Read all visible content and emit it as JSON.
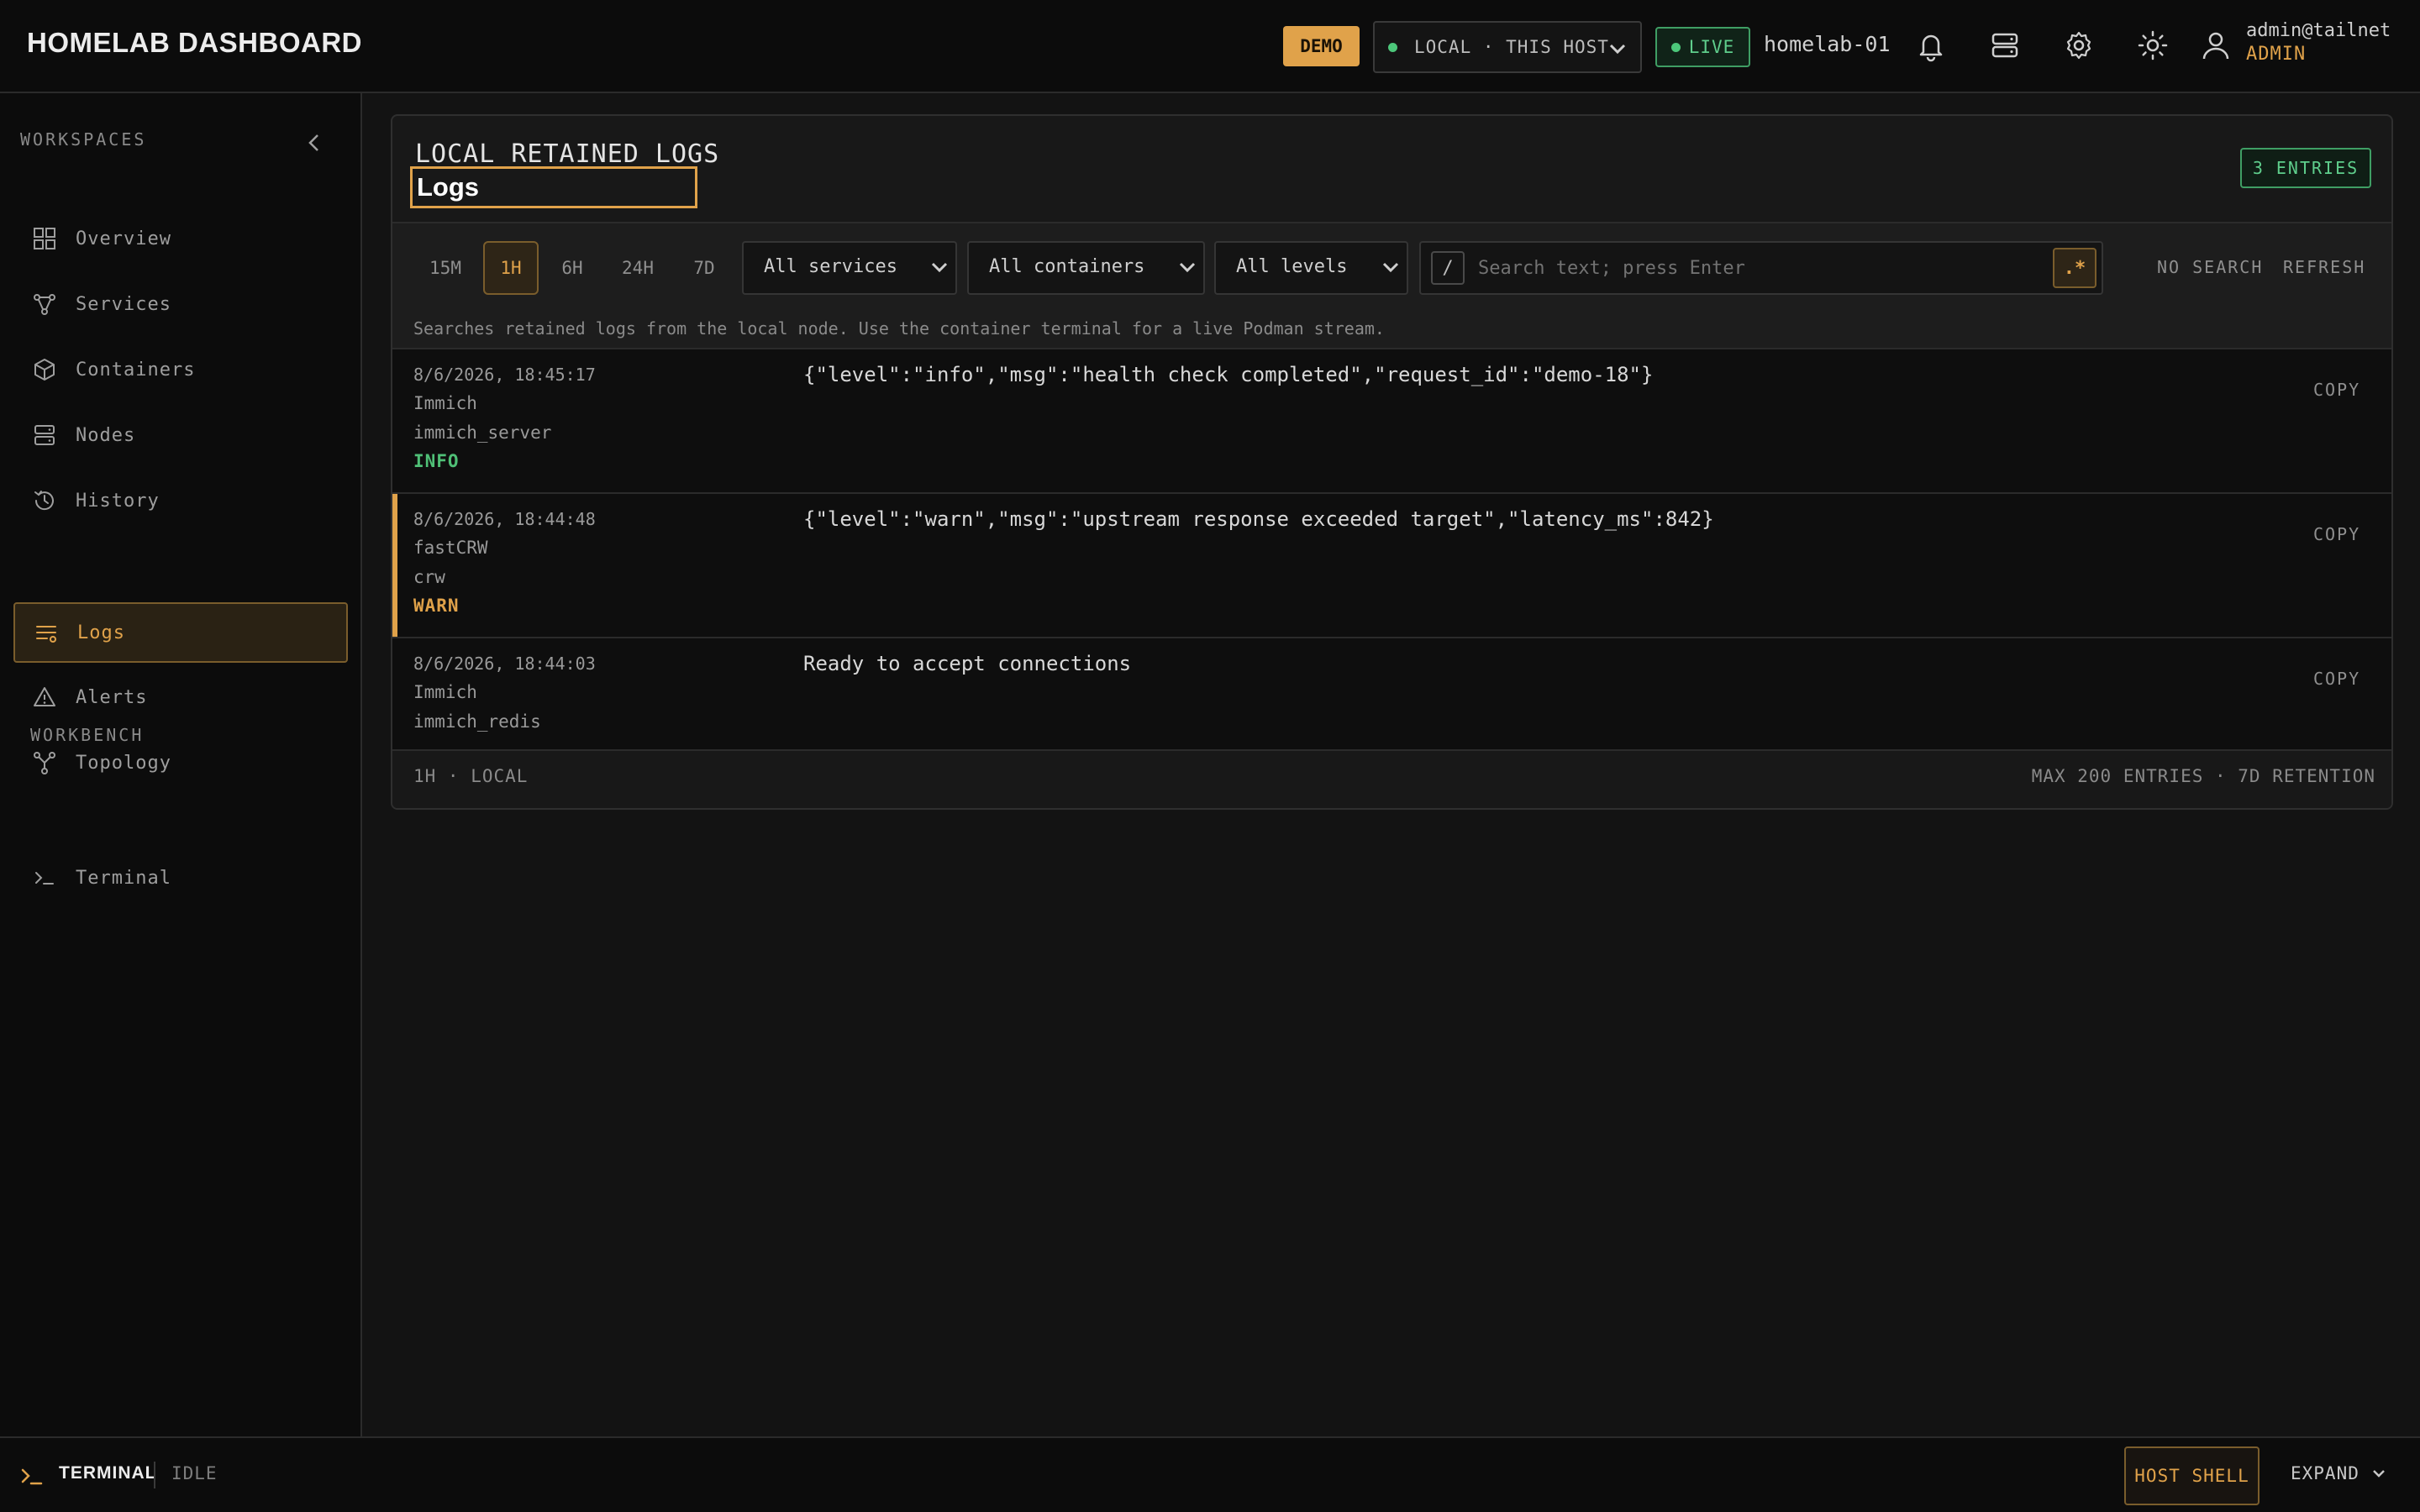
{
  "header": {
    "title": "HOMELAB DASHBOARD",
    "demo_badge": "DEMO",
    "host_select": "LOCAL · THIS HOST",
    "live_label": "LIVE",
    "host_name": "homelab-01",
    "icons": [
      "bell-icon",
      "server-icon",
      "gear-icon",
      "theme-sun-icon",
      "user-icon"
    ],
    "user_name": "admin@tailnet",
    "user_role": "ADMIN"
  },
  "sidebar": {
    "workspaces_label": "WORKSPACES",
    "items": [
      {
        "label": "Overview",
        "icon": "grid-icon",
        "active": false
      },
      {
        "label": "Services",
        "icon": "services-icon",
        "active": false
      },
      {
        "label": "Containers",
        "icon": "cube-icon",
        "active": false
      },
      {
        "label": "Nodes",
        "icon": "server-icon",
        "active": false
      },
      {
        "label": "History",
        "icon": "history-icon",
        "active": false
      },
      {
        "label": "Logs",
        "icon": "logs-icon",
        "active": true
      },
      {
        "label": "Alerts",
        "icon": "alert-icon",
        "active": false
      },
      {
        "label": "Topology",
        "icon": "topology-icon",
        "active": false
      }
    ],
    "workbench_label": "WORKBENCH",
    "workbench_items": [
      {
        "label": "Terminal",
        "icon": "terminal-icon"
      }
    ]
  },
  "logs": {
    "eyebrow": "LOCAL RETAINED LOGS",
    "title": "Logs",
    "entries_badge": "3 ENTRIES",
    "ranges": [
      "15M",
      "1H",
      "6H",
      "24H",
      "7D"
    ],
    "active_range": "1H",
    "filters": {
      "services": "All services",
      "containers": "All containers",
      "levels": "All levels"
    },
    "search": {
      "key_hint": "/",
      "placeholder": "Search text; press Enter",
      "value": "",
      "regex_label": ".*"
    },
    "no_search_label": "NO SEARCH",
    "refresh_label": "REFRESH",
    "hint": "Searches retained logs from the local node. Use the container terminal for a live Podman stream.",
    "copy_label": "COPY",
    "rows": [
      {
        "time": "8/6/2026, 18:45:17",
        "service": "Immich",
        "container": "immich_server",
        "level": "INFO",
        "message": "{\"level\":\"info\",\"msg\":\"health check completed\",\"request_id\":\"demo-18\"}"
      },
      {
        "time": "8/6/2026, 18:44:48",
        "service": "fastCRW",
        "container": "crw",
        "level": "WARN",
        "message": "{\"level\":\"warn\",\"msg\":\"upstream response exceeded target\",\"latency_ms\":842}"
      },
      {
        "time": "8/6/2026, 18:44:03",
        "service": "Immich",
        "container": "immich_redis",
        "level": "",
        "message": "Ready to accept connections"
      }
    ],
    "footer_left": "1H · LOCAL",
    "footer_right": "MAX 200 ENTRIES · 7D RETENTION"
  },
  "terminal_bar": {
    "label": "TERMINAL",
    "status": "IDLE",
    "host_shell_label": "HOST SHELL",
    "expand_label": "EXPAND"
  },
  "colors": {
    "accent": "#e0a24a",
    "success": "#4fbf76",
    "background": "#131313",
    "panel": "#0c0c0c"
  }
}
